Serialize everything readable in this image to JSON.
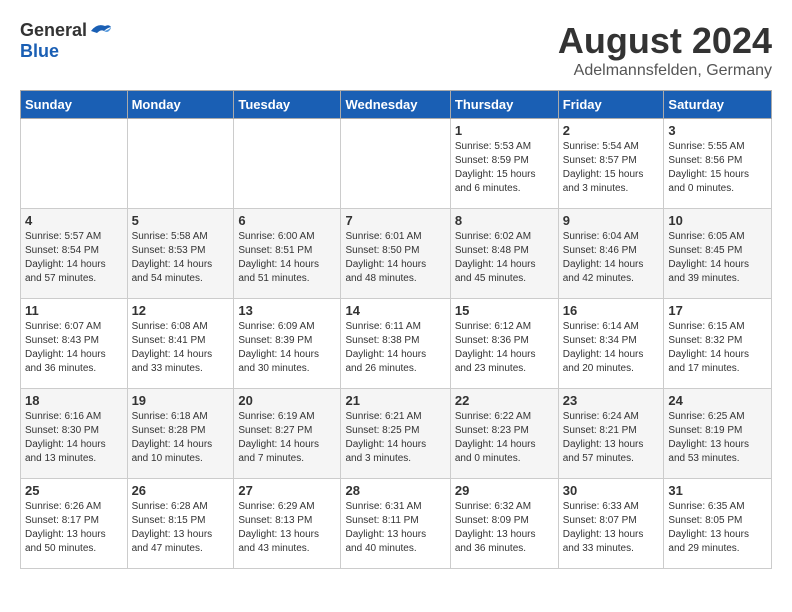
{
  "logo": {
    "general": "General",
    "blue": "Blue"
  },
  "title": {
    "month_year": "August 2024",
    "location": "Adelmannsfelden, Germany"
  },
  "headers": [
    "Sunday",
    "Monday",
    "Tuesday",
    "Wednesday",
    "Thursday",
    "Friday",
    "Saturday"
  ],
  "weeks": [
    [
      {
        "day": "",
        "info": ""
      },
      {
        "day": "",
        "info": ""
      },
      {
        "day": "",
        "info": ""
      },
      {
        "day": "",
        "info": ""
      },
      {
        "day": "1",
        "info": "Sunrise: 5:53 AM\nSunset: 8:59 PM\nDaylight: 15 hours\nand 6 minutes."
      },
      {
        "day": "2",
        "info": "Sunrise: 5:54 AM\nSunset: 8:57 PM\nDaylight: 15 hours\nand 3 minutes."
      },
      {
        "day": "3",
        "info": "Sunrise: 5:55 AM\nSunset: 8:56 PM\nDaylight: 15 hours\nand 0 minutes."
      }
    ],
    [
      {
        "day": "4",
        "info": "Sunrise: 5:57 AM\nSunset: 8:54 PM\nDaylight: 14 hours\nand 57 minutes."
      },
      {
        "day": "5",
        "info": "Sunrise: 5:58 AM\nSunset: 8:53 PM\nDaylight: 14 hours\nand 54 minutes."
      },
      {
        "day": "6",
        "info": "Sunrise: 6:00 AM\nSunset: 8:51 PM\nDaylight: 14 hours\nand 51 minutes."
      },
      {
        "day": "7",
        "info": "Sunrise: 6:01 AM\nSunset: 8:50 PM\nDaylight: 14 hours\nand 48 minutes."
      },
      {
        "day": "8",
        "info": "Sunrise: 6:02 AM\nSunset: 8:48 PM\nDaylight: 14 hours\nand 45 minutes."
      },
      {
        "day": "9",
        "info": "Sunrise: 6:04 AM\nSunset: 8:46 PM\nDaylight: 14 hours\nand 42 minutes."
      },
      {
        "day": "10",
        "info": "Sunrise: 6:05 AM\nSunset: 8:45 PM\nDaylight: 14 hours\nand 39 minutes."
      }
    ],
    [
      {
        "day": "11",
        "info": "Sunrise: 6:07 AM\nSunset: 8:43 PM\nDaylight: 14 hours\nand 36 minutes."
      },
      {
        "day": "12",
        "info": "Sunrise: 6:08 AM\nSunset: 8:41 PM\nDaylight: 14 hours\nand 33 minutes."
      },
      {
        "day": "13",
        "info": "Sunrise: 6:09 AM\nSunset: 8:39 PM\nDaylight: 14 hours\nand 30 minutes."
      },
      {
        "day": "14",
        "info": "Sunrise: 6:11 AM\nSunset: 8:38 PM\nDaylight: 14 hours\nand 26 minutes."
      },
      {
        "day": "15",
        "info": "Sunrise: 6:12 AM\nSunset: 8:36 PM\nDaylight: 14 hours\nand 23 minutes."
      },
      {
        "day": "16",
        "info": "Sunrise: 6:14 AM\nSunset: 8:34 PM\nDaylight: 14 hours\nand 20 minutes."
      },
      {
        "day": "17",
        "info": "Sunrise: 6:15 AM\nSunset: 8:32 PM\nDaylight: 14 hours\nand 17 minutes."
      }
    ],
    [
      {
        "day": "18",
        "info": "Sunrise: 6:16 AM\nSunset: 8:30 PM\nDaylight: 14 hours\nand 13 minutes."
      },
      {
        "day": "19",
        "info": "Sunrise: 6:18 AM\nSunset: 8:28 PM\nDaylight: 14 hours\nand 10 minutes."
      },
      {
        "day": "20",
        "info": "Sunrise: 6:19 AM\nSunset: 8:27 PM\nDaylight: 14 hours\nand 7 minutes."
      },
      {
        "day": "21",
        "info": "Sunrise: 6:21 AM\nSunset: 8:25 PM\nDaylight: 14 hours\nand 3 minutes."
      },
      {
        "day": "22",
        "info": "Sunrise: 6:22 AM\nSunset: 8:23 PM\nDaylight: 14 hours\nand 0 minutes."
      },
      {
        "day": "23",
        "info": "Sunrise: 6:24 AM\nSunset: 8:21 PM\nDaylight: 13 hours\nand 57 minutes."
      },
      {
        "day": "24",
        "info": "Sunrise: 6:25 AM\nSunset: 8:19 PM\nDaylight: 13 hours\nand 53 minutes."
      }
    ],
    [
      {
        "day": "25",
        "info": "Sunrise: 6:26 AM\nSunset: 8:17 PM\nDaylight: 13 hours\nand 50 minutes."
      },
      {
        "day": "26",
        "info": "Sunrise: 6:28 AM\nSunset: 8:15 PM\nDaylight: 13 hours\nand 47 minutes."
      },
      {
        "day": "27",
        "info": "Sunrise: 6:29 AM\nSunset: 8:13 PM\nDaylight: 13 hours\nand 43 minutes."
      },
      {
        "day": "28",
        "info": "Sunrise: 6:31 AM\nSunset: 8:11 PM\nDaylight: 13 hours\nand 40 minutes."
      },
      {
        "day": "29",
        "info": "Sunrise: 6:32 AM\nSunset: 8:09 PM\nDaylight: 13 hours\nand 36 minutes."
      },
      {
        "day": "30",
        "info": "Sunrise: 6:33 AM\nSunset: 8:07 PM\nDaylight: 13 hours\nand 33 minutes."
      },
      {
        "day": "31",
        "info": "Sunrise: 6:35 AM\nSunset: 8:05 PM\nDaylight: 13 hours\nand 29 minutes."
      }
    ]
  ]
}
